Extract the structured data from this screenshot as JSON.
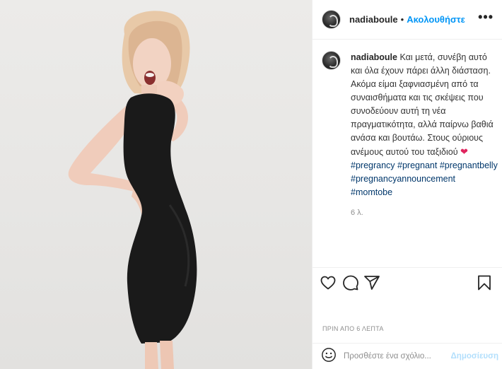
{
  "post": {
    "username": "nadiaboule",
    "separator": "•",
    "follow_label": "Ακολουθήστε",
    "more_label": "•••"
  },
  "caption": {
    "username": "nadiaboule",
    "text": "Και μετά, συνέβη αυτό και όλα έχουν πάρει άλλη διάσταση. Ακόμα είμαι ξαφνιασμένη από τα συναισθήματα και τις σκέψεις που συνοδεύουν αυτή τη νέα πραγματικότητα, αλλά παίρνω βαθιά ανάσα και βουτάω. Στους ούριους ανέμους αυτού του ταξιδιού",
    "emoji": "❤",
    "hashtags": [
      "#pregrancy",
      "#pregnant",
      "#pregnantbelly",
      "#pregnancyannouncement",
      "#momtobe"
    ],
    "relative_time": "6 λ."
  },
  "actions": {
    "like_icon": "heart-outline-icon",
    "comment_icon": "speech-bubble-icon",
    "share_icon": "paper-plane-icon",
    "save_icon": "bookmark-icon"
  },
  "timestamp": "ΠΡΙΝ ΑΠΟ 6 ΛΕΠΤΑ",
  "comment": {
    "emoji_icon": "smiley-face-icon",
    "placeholder": "Προσθέστε ένα σχόλιο...",
    "post_label": "Δημοσίευση"
  },
  "colors": {
    "link_blue": "#0095f6",
    "hashtag_blue": "#00376b",
    "muted": "#8e8e8e",
    "post_disabled": "#b2dffc",
    "heart_red": "#e0245e"
  }
}
